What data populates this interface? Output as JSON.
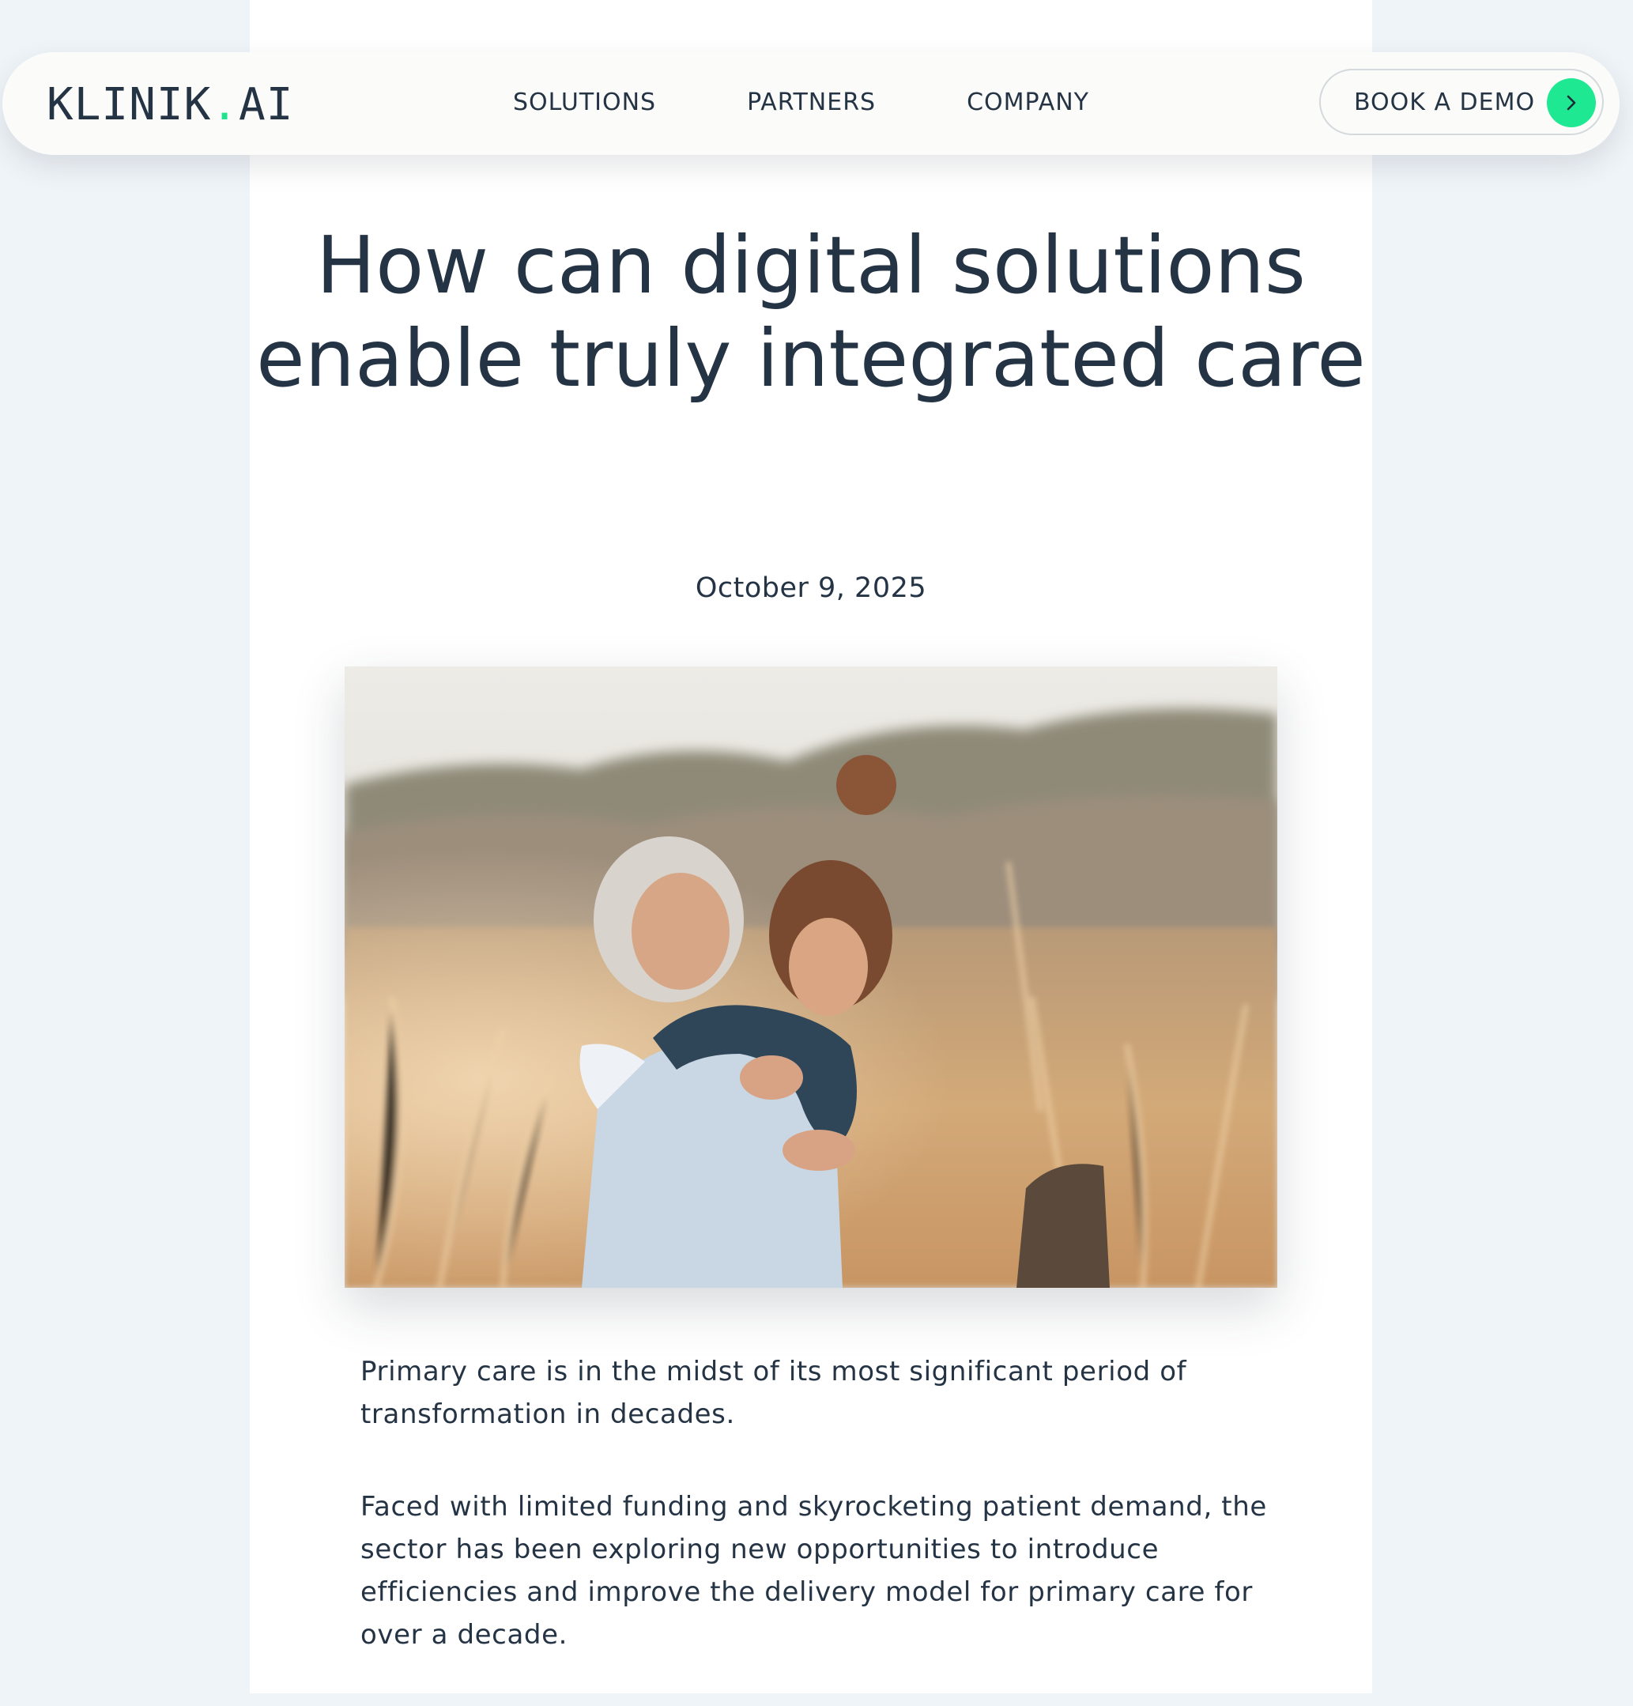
{
  "brand": {
    "logo_main": "KLINIK",
    "logo_dot": ".",
    "logo_suffix": "AI",
    "accent_color": "#1de38f",
    "text_color": "#253445",
    "background_color": "#eff4f8"
  },
  "nav": {
    "links": [
      {
        "label": "SOLUTIONS"
      },
      {
        "label": "PARTNERS"
      },
      {
        "label": "COMPANY"
      }
    ],
    "cta": {
      "label": "BOOK A DEMO",
      "icon": "chevron-right-icon"
    }
  },
  "article": {
    "title": "How can digital solutions enable truly integrated care",
    "date": "October 9, 2025",
    "hero_image": {
      "subject": "elderly woman hugged by a young girl in a sunlit grass field"
    },
    "paragraphs": [
      "Primary care is in the midst of its most significant period of transformation in decades.",
      "Faced with limited funding and skyrocketing patient demand, the sector has been exploring new opportunities to introduce efficiencies and improve the delivery model for primary care for over a decade."
    ]
  }
}
